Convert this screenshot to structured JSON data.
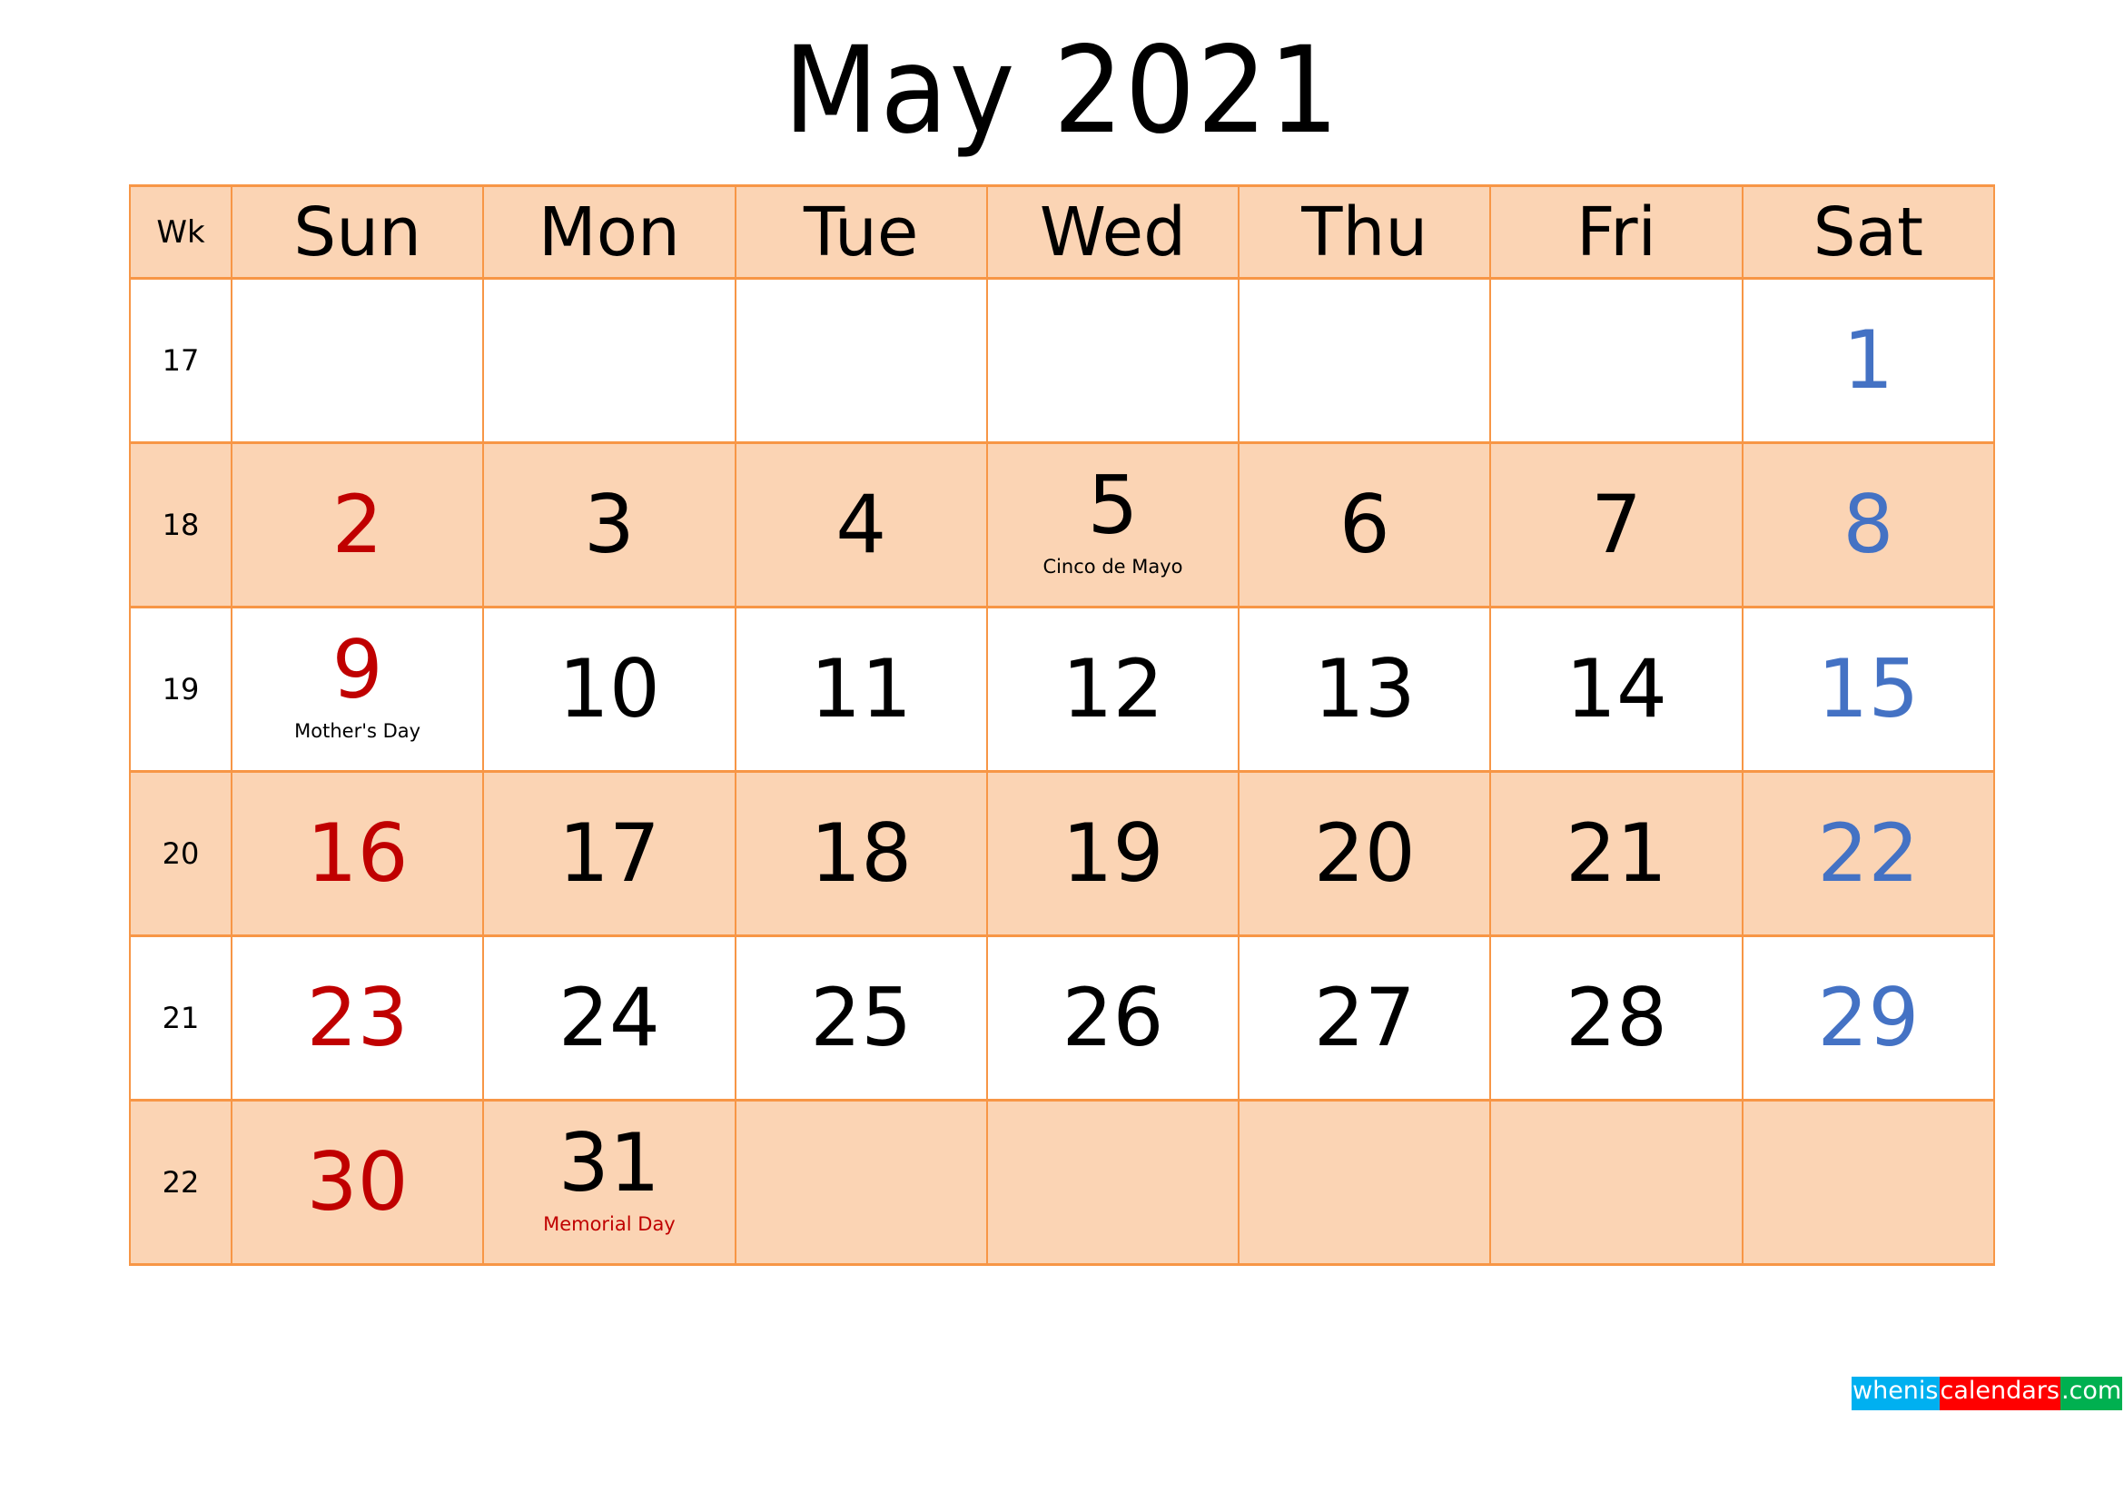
{
  "title": "May 2021",
  "colors": {
    "border": "#F79646",
    "shade": "#FBD4B4",
    "sunday": "#C00000",
    "saturday": "#4472C4",
    "weekday": "#000000"
  },
  "header": {
    "wk": "Wk",
    "days": [
      "Sun",
      "Mon",
      "Tue",
      "Wed",
      "Thu",
      "Fri",
      "Sat"
    ]
  },
  "weeks": [
    {
      "wk": "17",
      "days": [
        "",
        "",
        "",
        "",
        "",
        "",
        "1"
      ],
      "holidays": [
        "",
        "",
        "",
        "",
        "",
        "",
        ""
      ]
    },
    {
      "wk": "18",
      "days": [
        "2",
        "3",
        "4",
        "5",
        "6",
        "7",
        "8"
      ],
      "holidays": [
        "",
        "",
        "",
        "Cinco de Mayo",
        "",
        "",
        ""
      ]
    },
    {
      "wk": "19",
      "days": [
        "9",
        "10",
        "11",
        "12",
        "13",
        "14",
        "15"
      ],
      "holidays": [
        "Mother's Day",
        "",
        "",
        "",
        "",
        "",
        ""
      ]
    },
    {
      "wk": "20",
      "days": [
        "16",
        "17",
        "18",
        "19",
        "20",
        "21",
        "22"
      ],
      "holidays": [
        "",
        "",
        "",
        "",
        "",
        "",
        ""
      ]
    },
    {
      "wk": "21",
      "days": [
        "23",
        "24",
        "25",
        "26",
        "27",
        "28",
        "29"
      ],
      "holidays": [
        "",
        "",
        "",
        "",
        "",
        "",
        ""
      ]
    },
    {
      "wk": "22",
      "days": [
        "30",
        "31",
        "",
        "",
        "",
        "",
        ""
      ],
      "holidays": [
        "",
        "Memorial Day",
        "",
        "",
        "",
        "",
        ""
      ]
    }
  ],
  "holiday_colors": {
    "Cinco de Mayo": "black",
    "Mother's Day": "black",
    "Memorial Day": "red"
  },
  "logo": {
    "part1": "whenis",
    "part2": "calendars",
    "part3": ".com"
  }
}
